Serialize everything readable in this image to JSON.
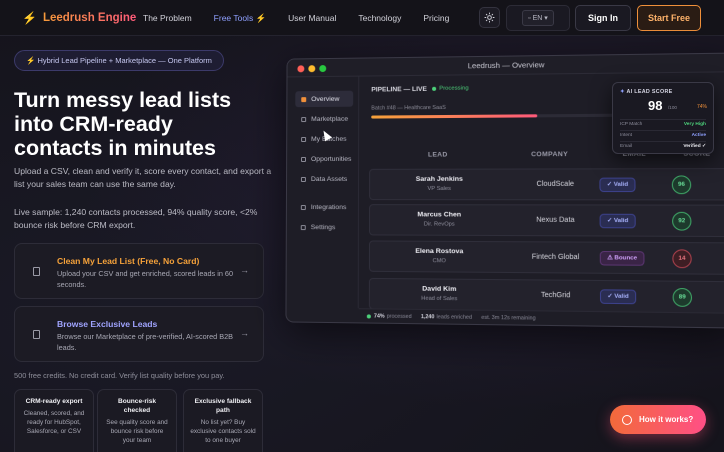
{
  "nav": {
    "logo": "Leedrush Engine",
    "links": [
      "The Problem",
      "Free Tools ⚡",
      "User Manual",
      "Technology",
      "Pricing"
    ],
    "active_link": "Free Tools ⚡",
    "lang": "EN",
    "signin": "Sign In",
    "start": "Start Free"
  },
  "hero": {
    "pill": "⚡ Hybrid Lead Pipeline + Marketplace — One Platform",
    "headline_lines": [
      "Turn messy lead lists",
      "into CRM-ready",
      "contacts in minutes"
    ],
    "sub1": "Upload a CSV, clean and verify it, score every contact, and export a list your sales team can use the same day.",
    "sub2": "Live sample: 1,240 contacts processed, 94% quality score, <2% bounce risk before CRM export.",
    "card1": {
      "title": "Clean My Lead List (Free, No Card)",
      "desc": "Upload your CSV and get enriched, scored leads in 60 seconds."
    },
    "card2": {
      "title": "Browse Exclusive Leads",
      "desc": "Browse our Marketplace of pre-verified, AI-scored B2B leads."
    },
    "credits": "500 free credits. No credit card. Verify list quality before you pay.",
    "features": [
      {
        "title": "CRM-ready export",
        "desc": "Cleaned, scored, and ready for HubSpot, Salesforce, or CSV"
      },
      {
        "title": "Bounce-risk checked",
        "desc": "See quality score and bounce risk before your team"
      },
      {
        "title": "Exclusive fallback path",
        "desc": "No list yet? Buy exclusive contacts sold to one buyer"
      }
    ]
  },
  "mockup": {
    "window_title": "Leedrush — Overview",
    "sidebar": [
      "Overview",
      "Marketplace",
      "My Batches",
      "Opportunities",
      "Data Assets",
      "Integrations",
      "Settings"
    ],
    "pipeline_label": "PIPELINE — LIVE",
    "status": "Processing",
    "batch": "Batch #48 — Healthcare SaaS",
    "progress": 0.66,
    "columns": [
      "LEAD",
      "COMPANY",
      "EMAIL",
      "SCORE"
    ],
    "rows": [
      {
        "name": "Sarah Jenkins",
        "role": "VP Sales",
        "company": "CloudScale",
        "email": "✓ Valid",
        "email_status": "valid",
        "score": "96",
        "score_status": "good"
      },
      {
        "name": "Marcus Chen",
        "role": "Dir. RevOps",
        "company": "Nexus Data",
        "email": "✓ Valid",
        "email_status": "valid",
        "score": "92",
        "score_status": "good"
      },
      {
        "name": "Elena Rostova",
        "role": "CMO",
        "company": "Fintech Global",
        "email": "⚠ Bounce",
        "email_status": "bounce",
        "score": "14",
        "score_status": "bad"
      },
      {
        "name": "David Kim",
        "role": "Head of Sales",
        "company": "TechGrid",
        "email": "✓ Valid",
        "email_status": "valid",
        "score": "89",
        "score_status": "good"
      }
    ],
    "footer": {
      "quality": "74%",
      "quality_label": "processed",
      "count": "1,240",
      "count_label": "leads enriched",
      "eta": "est. 3m 12s remaining"
    }
  },
  "score_card": {
    "title": "AI LEAD SCORE",
    "score": "98",
    "out_of": "/100",
    "pct": "74%",
    "rows": [
      {
        "label": "ICP Match",
        "value": "Very High",
        "color": "#4cd07a"
      },
      {
        "label": "Intent",
        "value": "Active",
        "color": "#8fa0ff"
      },
      {
        "label": "Email",
        "value": "Verified ✓",
        "color": "#e8e8ee"
      }
    ]
  },
  "chat_button": "How it works?"
}
